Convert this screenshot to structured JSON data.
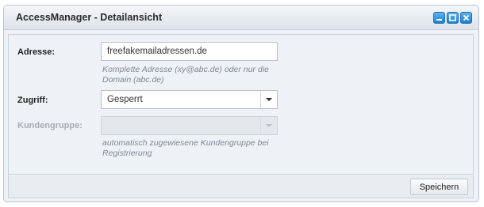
{
  "window": {
    "title": "AccessManager - Detailansicht",
    "controls": [
      "minimize-icon",
      "maximize-icon",
      "close-icon"
    ]
  },
  "form": {
    "adresse": {
      "label": "Adresse:",
      "value": "freefakemailadressen.de",
      "hint_line1": "Komplette Adresse (xy@abc.de) oder nur die",
      "hint_line2": "Domain (abc.de)"
    },
    "zugriff": {
      "label": "Zugriff:",
      "selected": "Gesperrt"
    },
    "kundengruppe": {
      "label": "Kundengruppe:",
      "selected": "",
      "disabled": true,
      "hint_line1": "automatisch zugewiesene Kundengruppe bei",
      "hint_line2": "Registrierung"
    }
  },
  "footer": {
    "save_label": "Speichern"
  },
  "colors": {
    "accent": "#1f7fcf",
    "panel": "#eef2f6",
    "border": "#b7c3d0"
  }
}
